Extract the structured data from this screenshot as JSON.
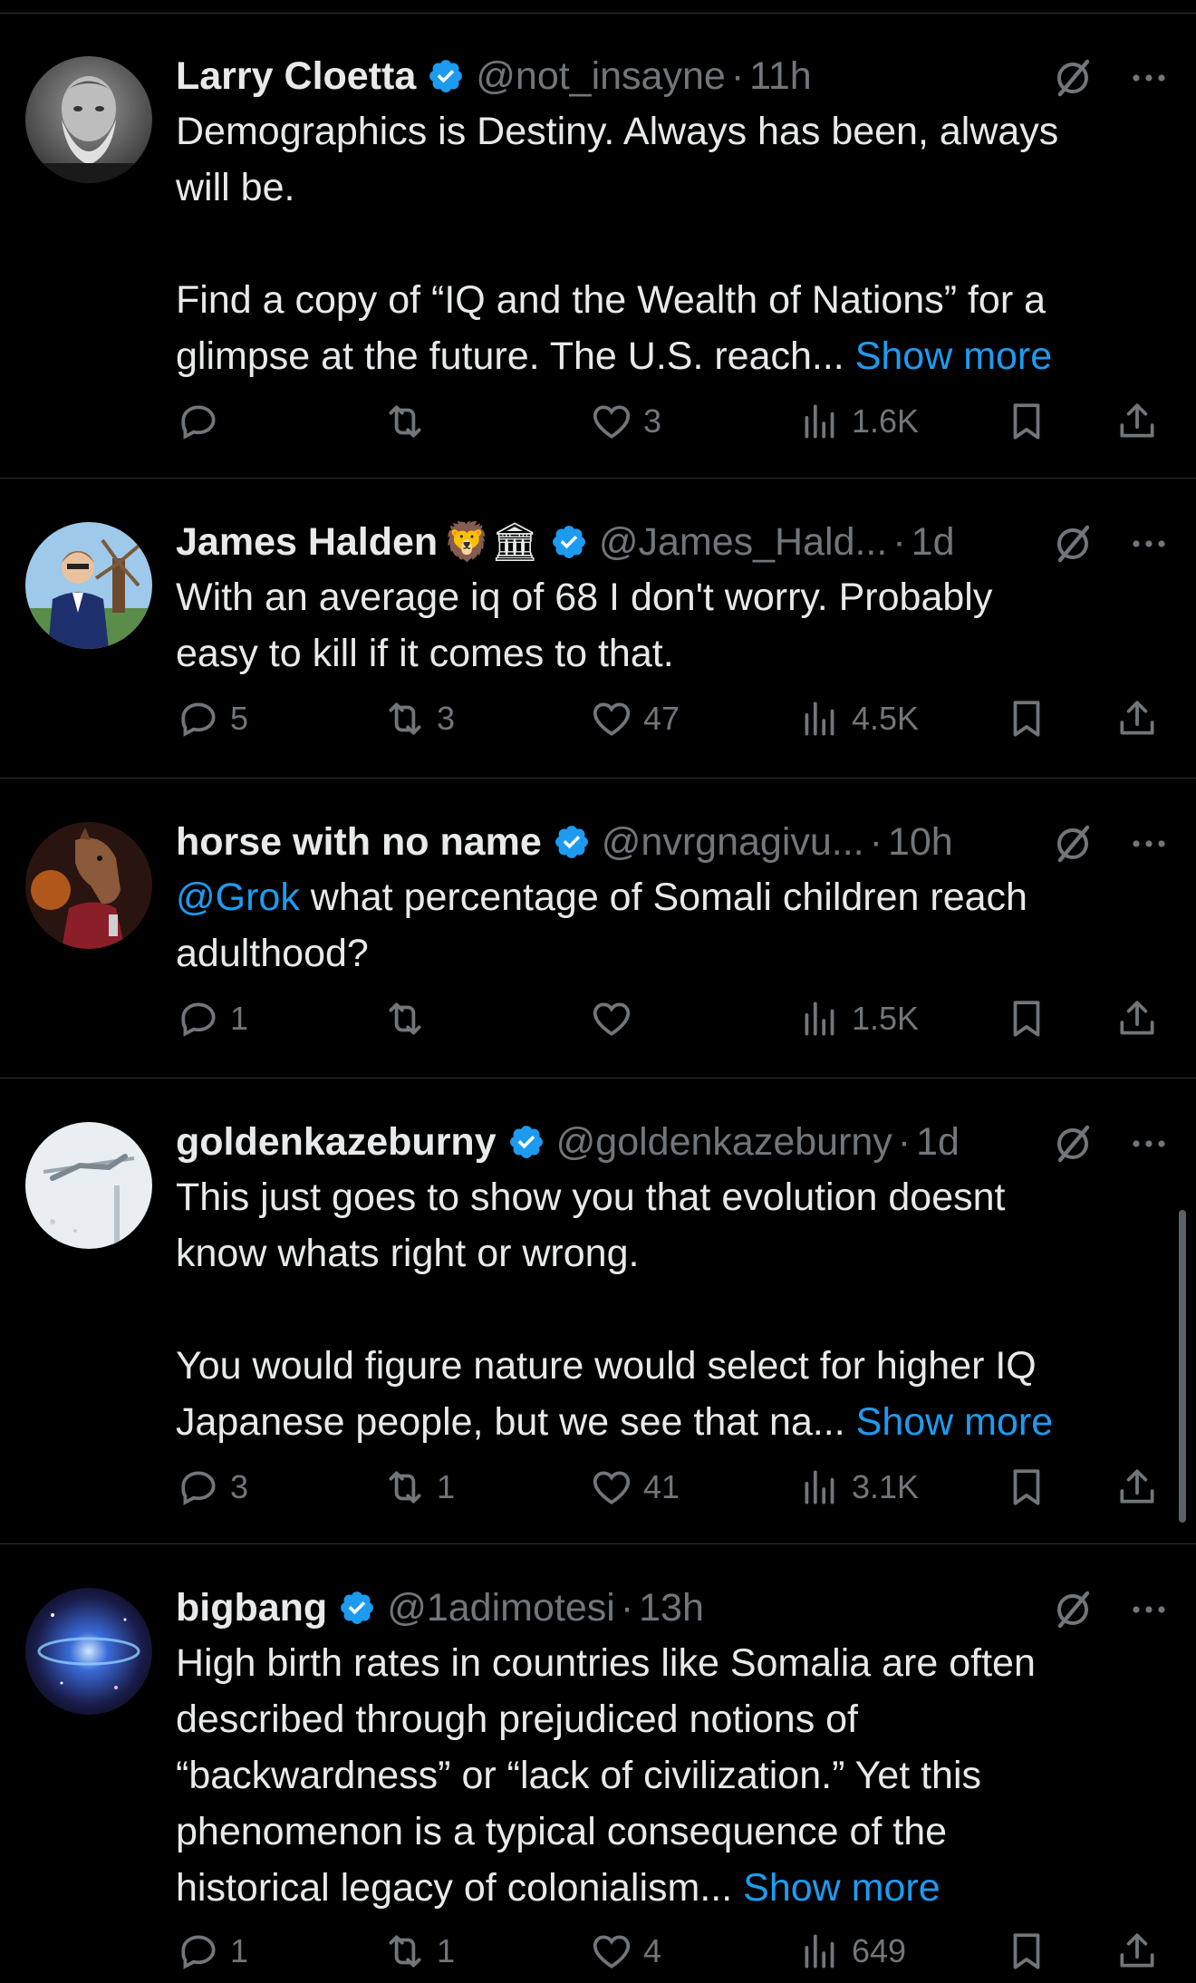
{
  "colors": {
    "background": "#000000",
    "text": "#e7e9ea",
    "muted": "#71767b",
    "accent": "#1d9bf0",
    "divider": "#2f3336"
  },
  "tweets": [
    {
      "name": "Larry Cloetta",
      "handle": "@not_insayne",
      "dot": "·",
      "time": "11h",
      "emojis": "",
      "text_pre": "",
      "mention": "",
      "text": "Demographics is Destiny. Always has been, always\nwill be.\n\nFind a copy of “IQ and the Wealth of Nations” for a\nglimpse at the future. The U.S. reach... ",
      "show_more": "Show more",
      "replies": "",
      "reposts": "",
      "likes": "3",
      "views": "1.6K"
    },
    {
      "name": "James Halden",
      "handle": "@James_Hald...",
      "dot": "·",
      "time": "1d",
      "emojis": "🦁🏛",
      "text_pre": "",
      "mention": "",
      "text": "With an average iq of 68 I don't worry. Probably\neasy to kill if it comes to that.",
      "show_more": "",
      "replies": "5",
      "reposts": "3",
      "likes": "47",
      "views": "4.5K"
    },
    {
      "name": "horse with no name",
      "handle": "@nvrgnagivu...",
      "dot": "·",
      "time": "10h",
      "emojis": "",
      "mention": "@Grok",
      "text": " what percentage of Somali children reach\nadulthood?",
      "show_more": "",
      "replies": "1",
      "reposts": "",
      "likes": "",
      "views": "1.5K"
    },
    {
      "name": "goldenkazeburny",
      "handle": "@goldenkazeburny",
      "dot": "·",
      "time": "1d",
      "emojis": "",
      "mention": "",
      "text": "This just goes to show you that evolution doesnt\nknow whats right or wrong.\n\nYou would figure nature would select for higher IQ\nJapanese people, but we see that na... ",
      "show_more": "Show more",
      "replies": "3",
      "reposts": "1",
      "likes": "41",
      "views": "3.1K"
    },
    {
      "name": "bigbang",
      "handle": "@1adimotesi",
      "dot": "·",
      "time": "13h",
      "emojis": "",
      "mention": "",
      "text": "High birth rates in countries like Somalia are often\ndescribed through prejudiced notions of\n“backwardness” or “lack of civilization.” Yet this\nphenomenon is a typical consequence of the\nhistorical legacy of colonialism... ",
      "show_more": "Show more",
      "replies": "1",
      "reposts": "1",
      "likes": "4",
      "views": "649"
    }
  ]
}
